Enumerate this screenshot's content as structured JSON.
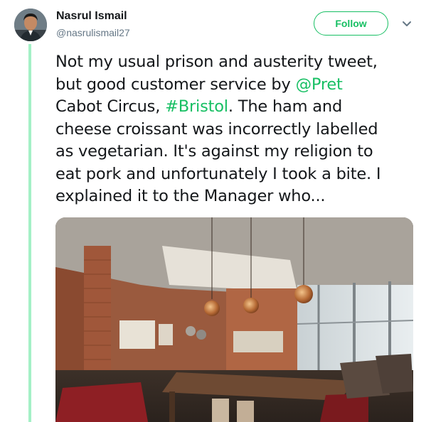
{
  "user": {
    "name": "Nasrul Ismail",
    "handle": "@nasrulismail27"
  },
  "actions": {
    "follow_label": "Follow",
    "caret_icon": "chevron-down-icon"
  },
  "tweet": {
    "line1": "Not my usual prison and austerity tweet,",
    "line2_pre": "but good customer service by ",
    "mention": "@Pret",
    "line3_pre": "Cabot Circus, ",
    "hashtag": "#Bristol",
    "line3_post": ". The ham and",
    "line4": "cheese croissant was incorrectly labelled",
    "line5": "as vegetarian. It's against my religion to",
    "line6": "eat pork and unfortunately I took a bite. I",
    "line7": "explained it to the Manager who..."
  },
  "colors": {
    "accent": "#17bf63",
    "thread_line": "#a4f0c6",
    "secondary_text": "#657786"
  }
}
